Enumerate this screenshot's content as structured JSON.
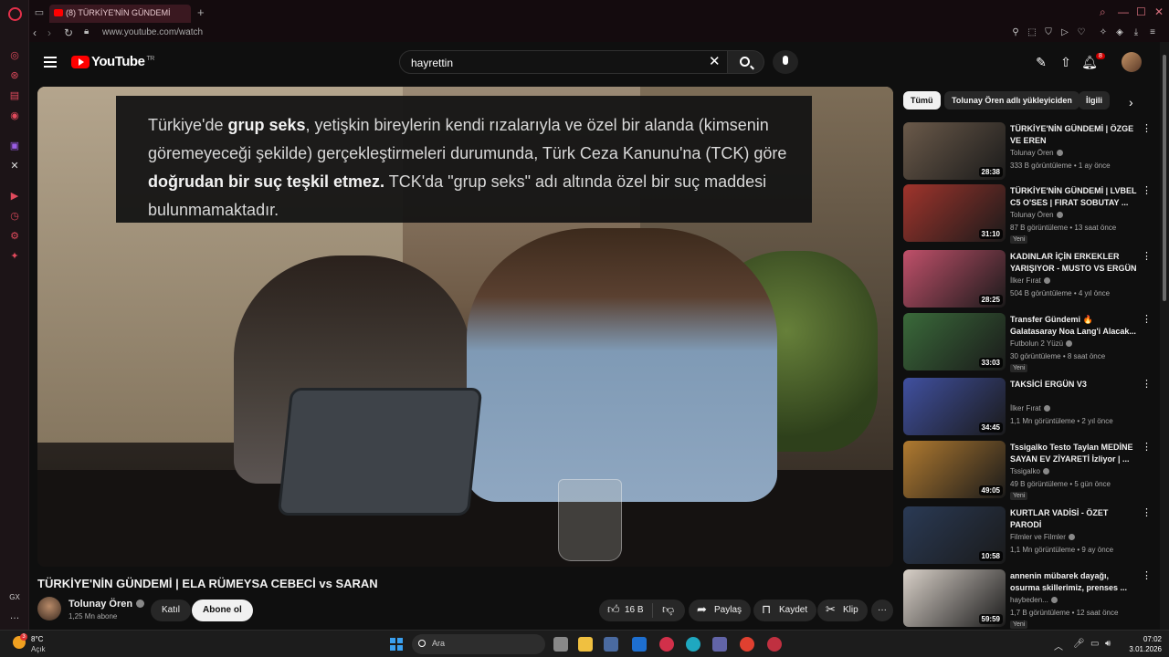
{
  "browser": {
    "tab_title": "(8) TÜRKİYE'NİN GÜNDEMİ",
    "url": "www.youtube.com/watch"
  },
  "youtube": {
    "logo_text": "YouTube",
    "logo_region": "TR",
    "search_value": "hayrettin",
    "notification_count": "8"
  },
  "player": {
    "caption_line1_pre": "Türkiye'de ",
    "caption_line1_bold": "grup seks",
    "caption_line1_post": ", yetişkin bireylerin kendi rızalarıyla ve özel bir alanda (kimsenin",
    "caption_line2": "göremeyeceği şekilde) gerçekleştirmeleri durumunda, Türk Ceza Kanunu'na (TCK) göre",
    "caption_line3_bold": "doğrudan bir suç teşkil etmez.",
    "caption_line3_post": " TCK'da \"grup seks\" adı altında özel bir suç maddesi",
    "caption_line4": "bulunmamaktadır."
  },
  "video": {
    "title": "TÜRKİYE'NİN GÜNDEMİ | ELA RÜMEYSA CEBECİ vs SARAN",
    "channel": "Tolunay Ören",
    "subscribers": "1,25 Mn abone",
    "join_label": "Katıl",
    "subscribe_label": "Abone ol",
    "like_count": "16 B",
    "share_label": "Paylaş",
    "save_label": "Kaydet",
    "clip_label": "Klip"
  },
  "chips": [
    "Tümü",
    "Tolunay Ören adlı yükleyiciden",
    "İlgili"
  ],
  "recommendations": [
    {
      "title": "TÜRKİYE'NİN GÜNDEMİ | ÖZGE VE EREN",
      "channel": "Tolunay Ören",
      "meta": "333 B görüntüleme • 1 ay önce",
      "duration": "28:38",
      "badge": "",
      "color": "#6b5a4a"
    },
    {
      "title": "TÜRKİYE'NİN GÜNDEMİ | LVBEL C5 O'SES | FIRAT SOBUTAY ...",
      "channel": "Tolunay Ören",
      "meta": "87 B görüntüleme • 13 saat önce",
      "duration": "31:10",
      "badge": "Yeni",
      "color": "#a0342c"
    },
    {
      "title": "KADINLAR İÇİN ERKEKLER YARIŞIYOR -  MUSTO VS ERGÜN",
      "channel": "İlker Fırat",
      "meta": "504 B görüntüleme • 4 yıl önce",
      "duration": "28:25",
      "badge": "",
      "color": "#c0506a"
    },
    {
      "title": "Transfer Gündemi 🔥 Galatasaray Noa Lang'i Alacak...",
      "channel": "Futbolun 2 Yüzü",
      "meta": "30 görüntüleme • 8 saat önce",
      "duration": "33:03",
      "badge": "Yeni",
      "color": "#3a6a3a"
    },
    {
      "title": "TAKSİCİ ERGÜN V3",
      "channel": "İlker Fırat",
      "meta": "1,1 Mn görüntüleme • 2 yıl önce",
      "duration": "34:45",
      "badge": "",
      "color": "#4050a0"
    },
    {
      "title": "Tssigalko Testo Taylan MEDİNE SAYAN EV ZİYARETİ İzliyor | ...",
      "channel": "Tssigalko",
      "meta": "49 B görüntüleme • 5 gün önce",
      "duration": "49:05",
      "badge": "Yeni",
      "color": "#b07a30"
    },
    {
      "title": "KURTLAR VADİSİ - ÖZET PARODİ",
      "channel": "Filmler ve Filmler",
      "meta": "1,1 Mn görüntüleme • 9 ay önce",
      "duration": "10:58",
      "badge": "",
      "color": "#2a3a55"
    },
    {
      "title": "annenin mübarek dayağı, osurma skillerimiz, prenses ...",
      "channel": "haybeden...",
      "meta": "1,7 B görüntüleme • 12 saat önce",
      "duration": "59:59",
      "badge": "Yeni",
      "color": "#d8d0c8"
    }
  ],
  "taskbar": {
    "temperature": "8°C",
    "condition": "Açık",
    "weather_badge": "3",
    "search_placeholder": "Ara",
    "time": "07:02",
    "date": "3.01.2026"
  }
}
